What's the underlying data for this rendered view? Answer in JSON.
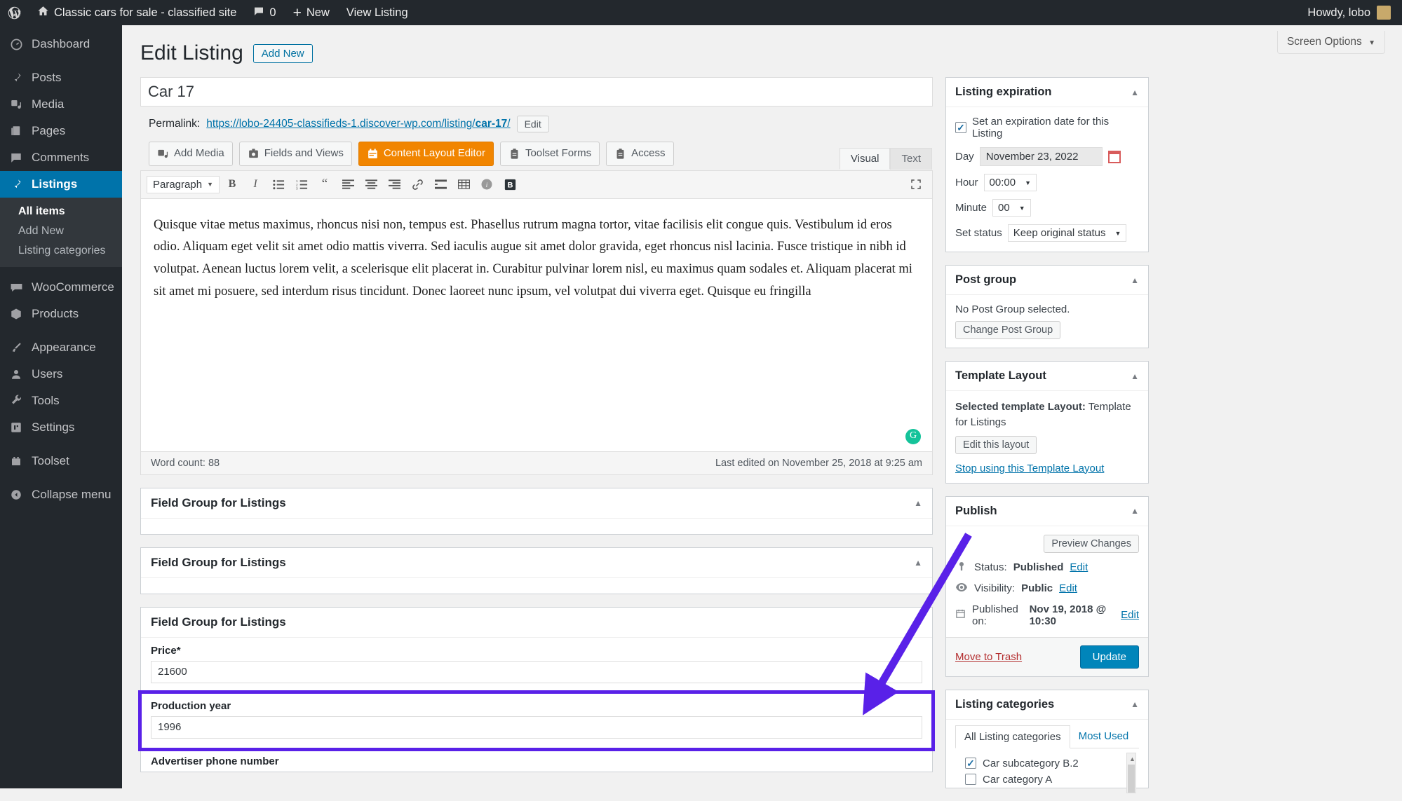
{
  "adminbar": {
    "logo_icon": "wordpress-logo-icon",
    "home_icon": "home-icon",
    "site_title": "Classic cars for sale - classified site",
    "comments_icon": "comment-bubble-icon",
    "comments_count": "0",
    "new_label": "New",
    "view_listing_label": "View Listing",
    "howdy": "Howdy, lobo"
  },
  "sidebar": {
    "items": [
      {
        "label": "Dashboard",
        "icon": "dashboard-icon"
      },
      {
        "label": "Posts",
        "icon": "pin-icon"
      },
      {
        "label": "Media",
        "icon": "media-icon"
      },
      {
        "label": "Pages",
        "icon": "page-icon"
      },
      {
        "label": "Comments",
        "icon": "comment-icon"
      },
      {
        "label": "Listings",
        "icon": "pin-icon"
      },
      {
        "label": "WooCommerce",
        "icon": "woocommerce-icon"
      },
      {
        "label": "Products",
        "icon": "box-icon"
      },
      {
        "label": "Appearance",
        "icon": "brush-icon"
      },
      {
        "label": "Users",
        "icon": "user-icon"
      },
      {
        "label": "Tools",
        "icon": "wrench-icon"
      },
      {
        "label": "Settings",
        "icon": "settings-icon"
      },
      {
        "label": "Toolset",
        "icon": "toolset-icon"
      },
      {
        "label": "Collapse menu",
        "icon": "collapse-icon"
      }
    ],
    "submenu": [
      {
        "label": "All items"
      },
      {
        "label": "Add New"
      },
      {
        "label": "Listing categories"
      }
    ]
  },
  "screen_options": {
    "label": "Screen Options",
    "caret": "▼"
  },
  "page": {
    "title": "Edit Listing",
    "add_new_label": "Add New",
    "post_title": "Car 17",
    "permalink_label": "Permalink:",
    "permalink_prefix": "https://lobo-24405-classifieds-1.discover-wp.com/listing/",
    "permalink_slug": "car-17",
    "permalink_suffix": "/",
    "permalink_edit_label": "Edit"
  },
  "media_buttons": [
    {
      "label": "Add Media",
      "icon": "add-media-icon",
      "active": false
    },
    {
      "label": "Fields and Views",
      "icon": "fields-views-icon",
      "active": false
    },
    {
      "label": "Content Layout Editor",
      "icon": "layout-editor-icon",
      "active": true
    },
    {
      "label": "Toolset Forms",
      "icon": "toolset-forms-icon",
      "active": false
    },
    {
      "label": "Access",
      "icon": "access-icon",
      "active": false
    }
  ],
  "editor": {
    "tabs": [
      {
        "label": "Visual",
        "active": true
      },
      {
        "label": "Text",
        "active": false
      }
    ],
    "format_select": "Paragraph",
    "format_caret": "▼",
    "toolbar_buttons": [
      {
        "icon": "bold-icon",
        "glyph": "B"
      },
      {
        "icon": "italic-icon",
        "glyph": "I"
      },
      {
        "icon": "bulleted-list-icon",
        "glyph": ""
      },
      {
        "icon": "numbered-list-icon",
        "glyph": ""
      },
      {
        "icon": "blockquote-icon",
        "glyph": "❝"
      },
      {
        "icon": "align-left-icon",
        "glyph": ""
      },
      {
        "icon": "align-center-icon",
        "glyph": ""
      },
      {
        "icon": "align-right-icon",
        "glyph": ""
      },
      {
        "icon": "link-icon",
        "glyph": "🔗"
      },
      {
        "icon": "read-more-icon",
        "glyph": ""
      },
      {
        "icon": "table-icon",
        "glyph": ""
      },
      {
        "icon": "toolbar-toggle-icon",
        "glyph": ""
      },
      {
        "icon": "bold-boxed-icon",
        "glyph": "B"
      }
    ],
    "fullscreen_icon": "fullscreen-icon",
    "body_text": "Quisque vitae metus maximus, rhoncus nisi non, tempus est. Phasellus rutrum magna tortor, vitae facilisis elit congue quis. Vestibulum id eros odio. Aliquam eget velit sit amet odio mattis viverra. Sed iaculis augue sit amet dolor gravida, eget rhoncus nisl lacinia. Fusce tristique in nibh id volutpat. Aenean luctus lorem velit, a scelerisque elit placerat in. Curabitur pulvinar lorem nisl, eu maximus quam sodales et. Aliquam placerat mi sit amet mi posuere, sed interdum risus tincidunt. Donec laoreet nunc ipsum, vel volutpat dui viverra eget. Quisque eu fringilla",
    "grammar_badge_icon": "grammarly-icon",
    "word_count": "Word count: 88",
    "last_edited": "Last edited on November 25, 2018 at 9:25 am"
  },
  "field_groups": [
    {
      "title": "Field Group for Listings",
      "toggle": "▲",
      "fields": []
    },
    {
      "title": "Field Group for Listings",
      "toggle": "▲",
      "fields": []
    },
    {
      "title": "Field Group for Listings",
      "toggle": "▲",
      "fields": [
        {
          "label": "Price*",
          "value": "21600",
          "highlighted": false
        },
        {
          "label": "Production year",
          "value": "1996",
          "highlighted": true
        },
        {
          "label": "Advertiser phone number",
          "value": "",
          "highlighted": false
        }
      ]
    }
  ],
  "side_panels": {
    "listing_expiration": {
      "title": "Listing expiration",
      "toggle": "▲",
      "checkbox_label": "Set an expiration date for this Listing",
      "checkbox_checked": true,
      "day_label": "Day",
      "day_value": "November 23, 2022",
      "calendar_icon": "calendar-icon",
      "hour_label": "Hour",
      "hour_value": "00:00",
      "minute_label": "Minute",
      "minute_value": "00",
      "status_label": "Set status",
      "status_value": "Keep original status",
      "caret": "▼"
    },
    "post_group": {
      "title": "Post group",
      "toggle": "▲",
      "empty_text": "No Post Group selected.",
      "button_label": "Change Post Group"
    },
    "template_layout": {
      "title": "Template Layout",
      "toggle": "▲",
      "selected_label": "Selected template Layout:",
      "selected_value": "Template for Listings",
      "edit_button": "Edit this layout",
      "stop_link": "Stop using this Template Layout"
    },
    "publish": {
      "title": "Publish",
      "toggle": "▲",
      "preview_button": "Preview Changes",
      "status_icon": "pin-status-icon",
      "status_label": "Status:",
      "status_value": "Published",
      "status_edit": "Edit",
      "visibility_icon": "eye-icon",
      "visibility_label": "Visibility:",
      "visibility_value": "Public",
      "visibility_edit": "Edit",
      "published_icon": "calendar-icon",
      "published_label": "Published on:",
      "published_value": "Nov 19, 2018 @ 10:30",
      "published_edit": "Edit",
      "trash_link": "Move to Trash",
      "update_button": "Update"
    },
    "listing_categories": {
      "title": "Listing categories",
      "toggle": "▲",
      "tabs": [
        {
          "label": "All Listing categories",
          "active": true
        },
        {
          "label": "Most Used",
          "active": false
        }
      ],
      "items": [
        {
          "label": "Car subcategory B.2",
          "checked": true
        },
        {
          "label": "Car category A",
          "checked": false
        }
      ]
    }
  },
  "annotation": {
    "arrow_color": "#5921e8",
    "highlight_color": "#5921e8"
  }
}
